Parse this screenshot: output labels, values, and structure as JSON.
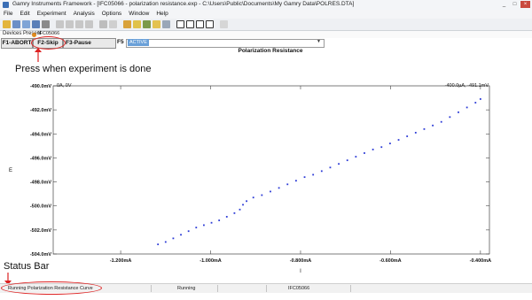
{
  "window": {
    "title": "Gamry Instruments Framework - [IFC05066 - polarization resistance.exp - C:\\Users\\Public\\Documents\\My Gamry Data\\POLRES.DTA]",
    "controls": [
      "_",
      "□",
      "×"
    ]
  },
  "menu": {
    "items": [
      "File",
      "Edit",
      "Experiment",
      "Analysis",
      "Options",
      "Window",
      "Help"
    ]
  },
  "devices": {
    "label": "Devices Present",
    "device": "IFC05066"
  },
  "function_keys": {
    "f1": "F1-ABORT",
    "f2": "F2-Skip",
    "f3": "F3-Pause",
    "f5_label": "F5",
    "f5_value": "ACTIVE"
  },
  "annotations": {
    "press_when_done": "Press when experiment is done",
    "status_bar": "Status Bar"
  },
  "chart_data": {
    "type": "scatter",
    "title": "Polarization Resistance",
    "origin_label": "0A, 0V",
    "cursor_readout": "-400.0µA, -491.1mV",
    "xlabel": "I",
    "ylabel": "E",
    "xlim": [
      -1.35,
      -0.38
    ],
    "ylim": [
      -504.0,
      -490.0
    ],
    "x_ticks": [
      "-1.200mA",
      "-1.000mA",
      "-0.800mA",
      "-0.600mA",
      "-0.400mA"
    ],
    "y_ticks": [
      "-490.0mV",
      "-492.0mV",
      "-494.0mV",
      "-496.0mV",
      "-498.0mV",
      "-500.0mV",
      "-502.0mV",
      "-504.0mV"
    ],
    "x_tick_values": [
      -1.2,
      -1.0,
      -0.8,
      -0.6,
      -0.4
    ],
    "y_tick_values": [
      -490,
      -492,
      -494,
      -496,
      -498,
      -500,
      -502,
      -504
    ],
    "color": "#2b3ad6",
    "points": [
      [
        -1.117,
        -503.2
      ],
      [
        -1.1,
        -503.0
      ],
      [
        -1.083,
        -502.7
      ],
      [
        -1.066,
        -502.4
      ],
      [
        -1.049,
        -502.1
      ],
      [
        -1.032,
        -501.8
      ],
      [
        -1.015,
        -501.6
      ],
      [
        -0.998,
        -501.4
      ],
      [
        -0.981,
        -501.2
      ],
      [
        -0.964,
        -500.9
      ],
      [
        -0.947,
        -500.6
      ],
      [
        -0.935,
        -500.3
      ],
      [
        -0.928,
        -499.9
      ],
      [
        -0.92,
        -499.6
      ],
      [
        -0.905,
        -499.3
      ],
      [
        -0.886,
        -499.1
      ],
      [
        -0.867,
        -498.8
      ],
      [
        -0.848,
        -498.5
      ],
      [
        -0.829,
        -498.2
      ],
      [
        -0.81,
        -497.9
      ],
      [
        -0.791,
        -497.6
      ],
      [
        -0.772,
        -497.4
      ],
      [
        -0.753,
        -497.1
      ],
      [
        -0.734,
        -496.8
      ],
      [
        -0.715,
        -496.5
      ],
      [
        -0.696,
        -496.2
      ],
      [
        -0.677,
        -495.9
      ],
      [
        -0.658,
        -495.6
      ],
      [
        -0.639,
        -495.3
      ],
      [
        -0.62,
        -495.1
      ],
      [
        -0.601,
        -494.8
      ],
      [
        -0.582,
        -494.5
      ],
      [
        -0.563,
        -494.2
      ],
      [
        -0.544,
        -493.9
      ],
      [
        -0.525,
        -493.6
      ],
      [
        -0.506,
        -493.3
      ],
      [
        -0.487,
        -493.0
      ],
      [
        -0.468,
        -492.6
      ],
      [
        -0.449,
        -492.2
      ],
      [
        -0.43,
        -491.8
      ],
      [
        -0.411,
        -491.4
      ],
      [
        -0.4,
        -491.1
      ]
    ]
  },
  "status": {
    "message": "Running Polarization Resistance Curve",
    "state": "Running",
    "device": "IFC05066"
  }
}
